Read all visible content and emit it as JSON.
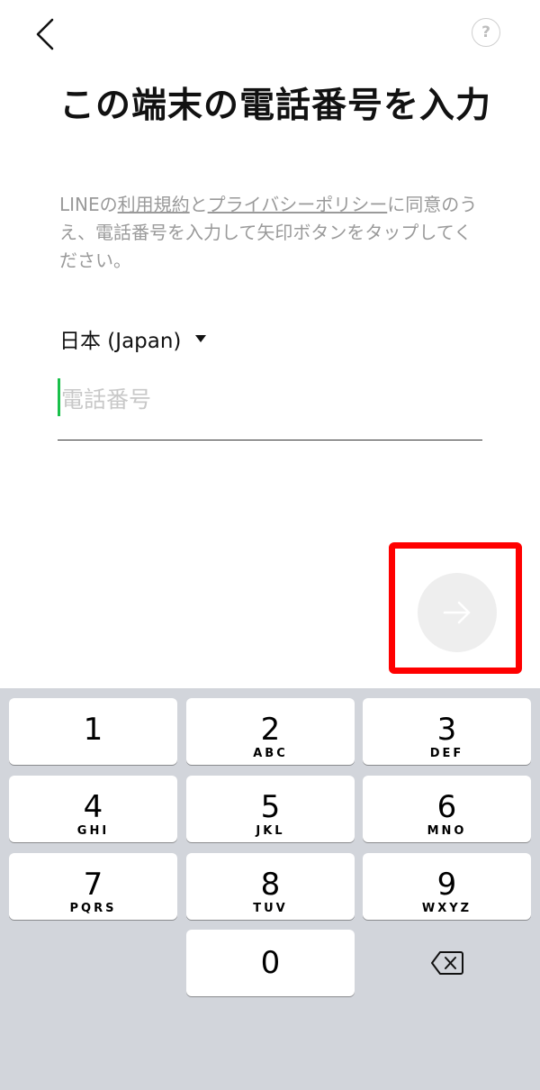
{
  "header": {
    "back_icon": "chevron-left-icon",
    "help_label": "?"
  },
  "title": "この端末の電話番号を入力",
  "description": {
    "prefix": "LINEの",
    "terms_link": "利用規約",
    "and": "と",
    "privacy_link": "プライバシーポリシー",
    "suffix": "に同意のうえ、電話番号を入力して矢印ボタンをタップしてください。"
  },
  "country": {
    "label": "日本 (Japan)"
  },
  "phone": {
    "placeholder": "電話番号",
    "value": ""
  },
  "next_button": {
    "icon": "arrow-right-icon"
  },
  "colors": {
    "accent_cursor": "#19c04a",
    "highlight": "#ff0000",
    "keyboard_bg": "#d2d5db",
    "disabled_button": "#eeeeee"
  },
  "keypad": {
    "keys": [
      {
        "digit": "1",
        "letters": ""
      },
      {
        "digit": "2",
        "letters": "ABC"
      },
      {
        "digit": "3",
        "letters": "DEF"
      },
      {
        "digit": "4",
        "letters": "GHI"
      },
      {
        "digit": "5",
        "letters": "JKL"
      },
      {
        "digit": "6",
        "letters": "MNO"
      },
      {
        "digit": "7",
        "letters": "PQRS"
      },
      {
        "digit": "8",
        "letters": "TUV"
      },
      {
        "digit": "9",
        "letters": "WXYZ"
      },
      {
        "digit": "0",
        "letters": ""
      }
    ],
    "delete_icon": "backspace-icon"
  }
}
